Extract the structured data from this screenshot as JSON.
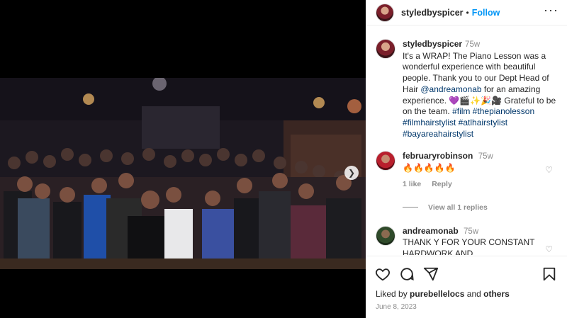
{
  "header": {
    "username": "styledbyspicer",
    "separator": "•",
    "follow_label": "Follow",
    "more_icon": "more-horizontal-icon"
  },
  "caption": {
    "username": "styledbyspicer",
    "time": "75w",
    "text_before_mention": "It's a WRAP! The Piano Lesson was a wonderful experience with beautiful people. Thank you to our Dept Head of Hair ",
    "mention": "@andreamonab",
    "text_after_mention": " for an amazing experience. 💜🎬✨🎉🎥 Grateful to be on the team.",
    "hashtags": "#film #thepianolesson #filmhairstylist #atlhairstylist #bayareahairstylist"
  },
  "comments": [
    {
      "username": "februaryrobinson",
      "time": "75w",
      "text": "🔥🔥🔥🔥🔥",
      "likes": "1 like",
      "reply_label": "Reply",
      "view_replies": "View all 1 replies"
    },
    {
      "username": "andreamonab",
      "time": "75w",
      "text": "THANK Y FOR YOUR CONSTANT HARDWORK AND SUPPORT...LOVE"
    }
  ],
  "footer": {
    "liked_by_prefix": "Liked by",
    "liked_by_user": "purebellelocs",
    "liked_by_and": "and",
    "liked_by_others": "others",
    "date": "June 8, 2023"
  },
  "icons": {
    "like": "heart-icon",
    "comment": "comment-icon",
    "share": "share-icon",
    "save": "bookmark-icon",
    "next": "chevron-right-icon"
  },
  "colors": {
    "link_blue": "#0095f6",
    "hashtag_blue": "#00376b",
    "muted": "#8e8e8e"
  }
}
